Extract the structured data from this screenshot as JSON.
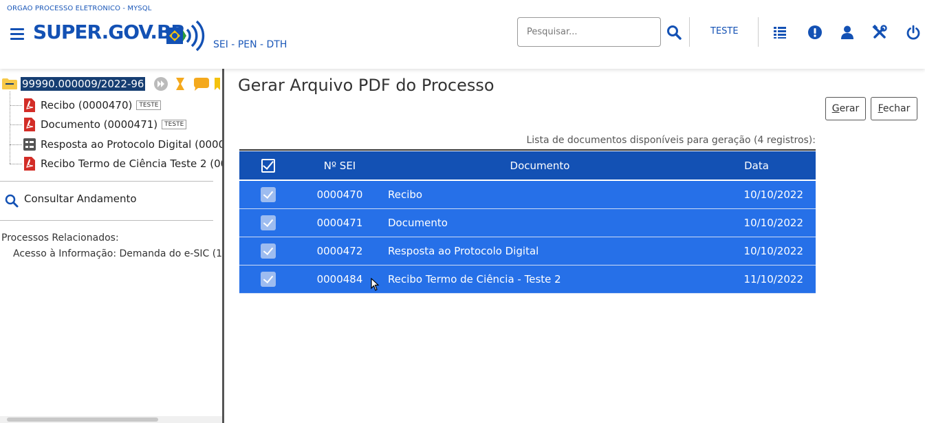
{
  "header": {
    "org": "ORGAO PROCESSO ELETRONICO - MYSQL",
    "logo": "SUPER.GOV.BR",
    "subtitle": "SEI - PEN - DTH",
    "search_placeholder": "Pesquisar...",
    "user": "TESTE",
    "icons": [
      "menu-icon",
      "search-icon",
      "list-icon",
      "alert-icon",
      "user-icon",
      "tools-icon",
      "power-icon"
    ],
    "brand_color": "#1351b4"
  },
  "tree": {
    "process_number": "99990.000009/2022-96",
    "items": [
      {
        "label": "Recibo (0000470)",
        "badge": "TESTE",
        "icon": "pdf-icon"
      },
      {
        "label": "Documento (0000471)",
        "badge": "TESTE",
        "icon": "pdf-icon"
      },
      {
        "label": "Resposta ao Protocolo Digital (00004",
        "badge": "",
        "icon": "form-icon"
      },
      {
        "label": "Recibo Termo de Ciência Teste 2 (000",
        "badge": "",
        "icon": "pdf-icon"
      }
    ],
    "consult": "Consultar Andamento",
    "related_title": "Processos Relacionados:",
    "related_item": "Acesso à Informação: Demanda do e-SIC (1"
  },
  "main": {
    "title": "Gerar Arquivo PDF do Processo",
    "gerar_first": "G",
    "gerar_rest": "erar",
    "fechar_first": "F",
    "fechar_rest": "echar",
    "caption": "Lista de documentos disponíveis para geração (4 registros):",
    "columns": [
      "Nº SEI",
      "Documento",
      "Data"
    ],
    "rows": [
      {
        "num": "0000470",
        "doc": "Recibo",
        "date": "10/10/2022",
        "checked": true
      },
      {
        "num": "0000471",
        "doc": "Documento",
        "date": "10/10/2022",
        "checked": true
      },
      {
        "num": "0000472",
        "doc": "Resposta ao Protocolo Digital",
        "date": "10/10/2022",
        "checked": true
      },
      {
        "num": "0000484",
        "doc": "Recibo Termo de Ciência - Teste 2",
        "date": "11/10/2022",
        "checked": true
      }
    ],
    "header_color": "#1351b4",
    "row_color": "#2670e8"
  }
}
